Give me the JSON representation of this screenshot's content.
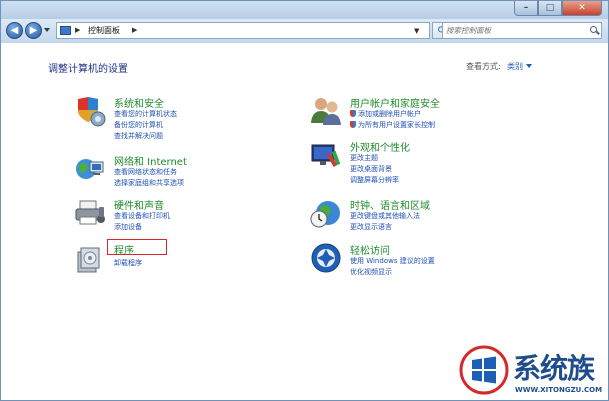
{
  "address_bar": {
    "path": "控制面板"
  },
  "search": {
    "placeholder": "搜索控制面板"
  },
  "main": {
    "heading": "调整计算机的设置",
    "view_by_label": "查看方式:",
    "view_by_value": "类别"
  },
  "categories": [
    {
      "title": "系统和安全",
      "links": [
        "查看您的计算机状态",
        "备份您的计算机",
        "查找并解决问题"
      ]
    },
    {
      "title": "网络和 Internet",
      "links": [
        "查看网络状态和任务",
        "选择家庭组和共享选项"
      ]
    },
    {
      "title": "硬件和声音",
      "links": [
        "查看设备和打印机",
        "添加设备"
      ]
    },
    {
      "title": "程序",
      "links": [
        "卸载程序"
      ]
    },
    {
      "title": "用户帐户和家庭安全",
      "links": [
        "添加或删除用户帐户",
        "为所有用户设置家长控制"
      ]
    },
    {
      "title": "外观和个性化",
      "links": [
        "更改主题",
        "更改桌面背景",
        "调整屏幕分辨率"
      ]
    },
    {
      "title": "时钟、语言和区域",
      "links": [
        "更改键盘或其他输入法",
        "更改显示语言"
      ]
    },
    {
      "title": "轻松访问",
      "links": [
        "使用 Windows 建议的设置",
        "优化视频显示"
      ]
    }
  ],
  "watermark": {
    "text": "系统族",
    "url": "WWW.XITONGZU.COM"
  },
  "colors": {
    "heading": "#1e3287",
    "category_title": "#1e8b2c",
    "link": "#1f4fb5",
    "highlight": "#d8262a"
  }
}
